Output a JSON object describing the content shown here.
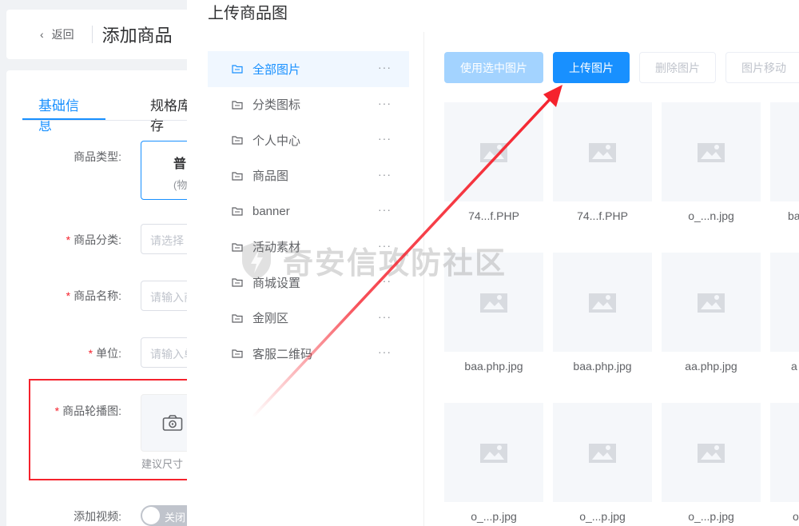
{
  "page": {
    "back_label": "返回",
    "title": "添加商品",
    "tabs": [
      {
        "label": "基础信息",
        "active": true
      },
      {
        "label": "规格库存",
        "active": false
      }
    ],
    "form": {
      "type_label": "商品类型:",
      "type_card_title": "普",
      "type_card_sub": "(物",
      "category_label": "商品分类:",
      "category_placeholder": "请选择",
      "name_label": "商品名称:",
      "name_placeholder": "请输入商",
      "unit_label": "单位:",
      "unit_placeholder": "请输入单",
      "carousel_label": "商品轮播图:",
      "carousel_hint": "建议尺寸",
      "video_label": "添加视频:",
      "video_switch": "关闭"
    }
  },
  "dialog": {
    "title": "上传商品图",
    "categories": [
      {
        "label": "全部图片",
        "active": true
      },
      {
        "label": "分类图标",
        "active": false
      },
      {
        "label": "个人中心",
        "active": false
      },
      {
        "label": "商品图",
        "active": false
      },
      {
        "label": "banner",
        "active": false
      },
      {
        "label": "活动素材",
        "active": false
      },
      {
        "label": "商城设置",
        "active": false
      },
      {
        "label": "金刚区",
        "active": false
      },
      {
        "label": "客服二维码",
        "active": false
      }
    ],
    "more_glyph": "···",
    "toolbar": {
      "use_selected": "使用选中图片",
      "upload": "上传图片",
      "delete": "删除图片",
      "move": "图片移动"
    },
    "images": [
      "74...f.PHP",
      "74...f.PHP",
      "o_...n.jpg",
      "ba",
      "baa.php.jpg",
      "baa.php.jpg",
      "aa.php.jpg",
      "a",
      "o_...p.jpg",
      "o_...p.jpg",
      "o_...p.jpg",
      "o"
    ]
  },
  "watermark": "奇安信攻防社区",
  "colors": {
    "primary": "#1890ff",
    "primary_disabled": "#a3d3ff",
    "annotation_red": "#f5222d"
  }
}
